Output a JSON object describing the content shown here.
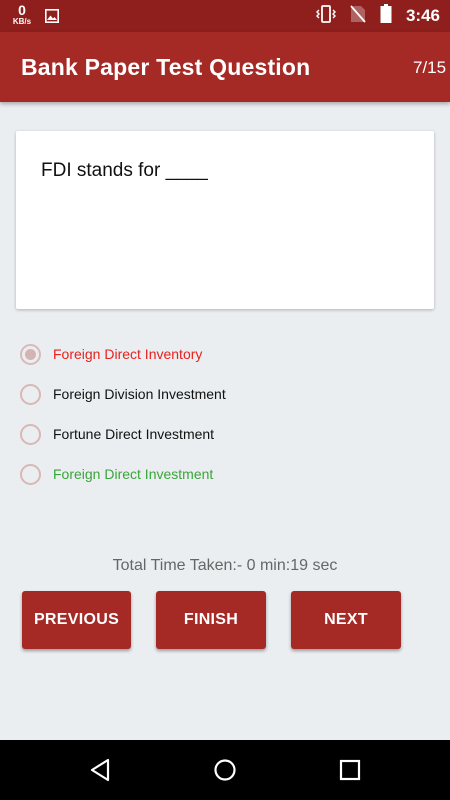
{
  "status_bar": {
    "data_rate": "0",
    "data_rate_unit": "KB/s",
    "time": "3:46"
  },
  "app_bar": {
    "title": "Bank Paper Test Question",
    "counter": "7/15"
  },
  "question": {
    "text": "FDI stands for ____"
  },
  "options": [
    {
      "label": "Foreign Direct Inventory",
      "state": "selected-wrong"
    },
    {
      "label": "Foreign Division Investment",
      "state": "normal"
    },
    {
      "label": "Fortune Direct Investment",
      "state": "normal"
    },
    {
      "label": "Foreign Direct Investment",
      "state": "correct"
    }
  ],
  "time_taken": "Total Time Taken:- 0 min:19 sec",
  "buttons": {
    "previous": "PREVIOUS",
    "finish": "FINISH",
    "next": "NEXT"
  },
  "colors": {
    "status_bar": "#8e1f1c",
    "app_bar": "#a52a26",
    "wrong": "#e8201e",
    "correct": "#3aa53a",
    "background": "#ebeef1"
  }
}
